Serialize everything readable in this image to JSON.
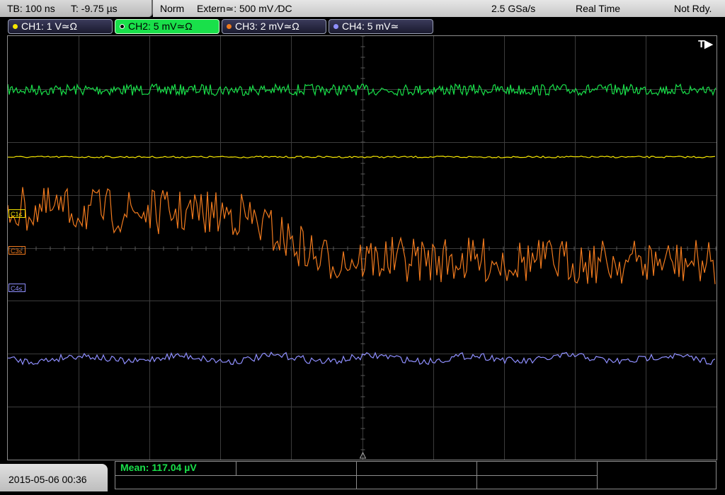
{
  "header": {
    "timebase": "TB: 100 ns",
    "trigger_time": "T: -9.75 µs",
    "acq_mode": "Norm",
    "trigger_source": "Extern≃: 500 mV ∕DC",
    "sample_rate": "2.5 GSa/s",
    "mode": "Real Time",
    "run_state": "Not Rdy."
  },
  "channels": [
    {
      "label": "CH1: 1 V≃Ω",
      "color": "#f5e600",
      "active": false
    },
    {
      "label": "CH2: 5 mV≃Ω",
      "color": "#19e04a",
      "active": true
    },
    {
      "label": "CH3: 2 mV≃Ω",
      "color": "#f07a1e",
      "active": false
    },
    {
      "label": "CH4: 5 mV≃",
      "color": "#8f8fff",
      "active": false
    }
  ],
  "markers": {
    "c1": "C1≤",
    "c3": "C3≤",
    "c4": "C4≤",
    "trigger_flag": "T▶"
  },
  "footer": {
    "datetime": "2015-05-06 00:36",
    "measurement": "Mean: 117.04 µV"
  },
  "colors": {
    "grid": "#3c3c3c",
    "ch1": "#f5e600",
    "ch2": "#19e04a",
    "ch3": "#f07a1e",
    "ch4": "#8f8fff"
  }
}
